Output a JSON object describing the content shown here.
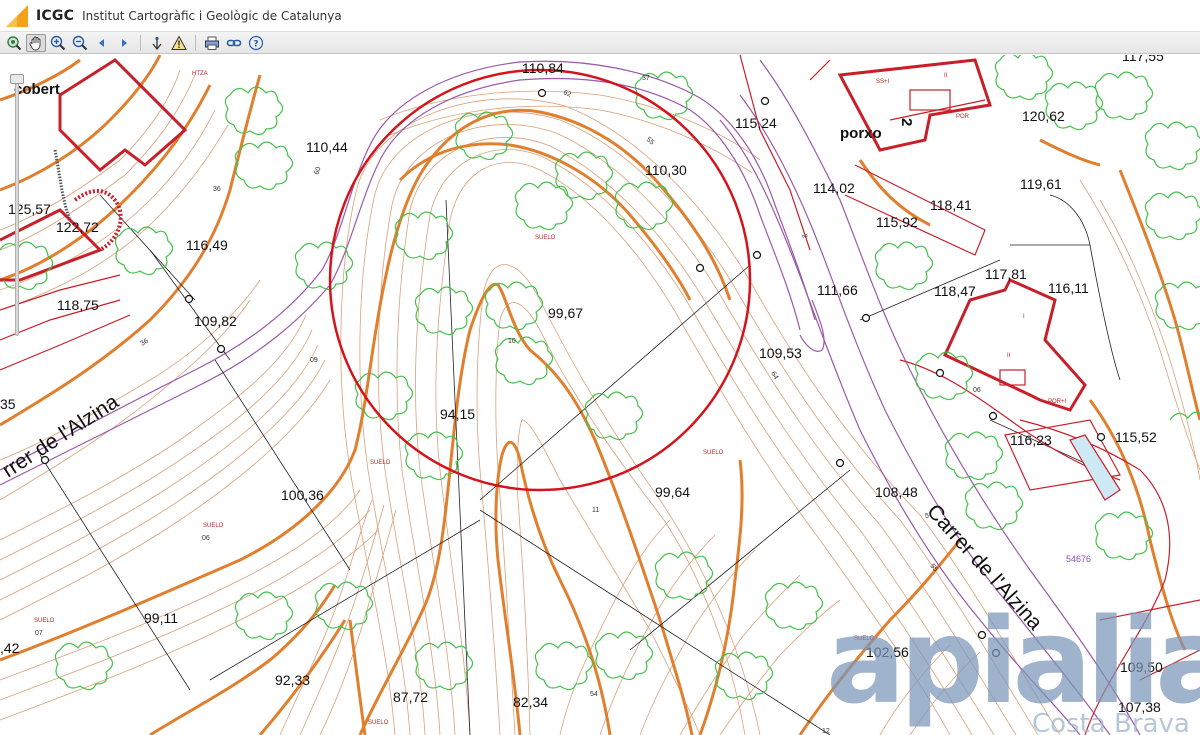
{
  "header": {
    "brand": "ICGC",
    "institution": "Institut Cartogràfic i Geològic de Catalunya"
  },
  "toolbar": {
    "buttons": [
      {
        "name": "zoom-extent-icon"
      },
      {
        "name": "pan-hand-icon",
        "active": true
      },
      {
        "name": "zoom-in-icon"
      },
      {
        "name": "zoom-out-icon"
      },
      {
        "name": "previous-view-icon"
      },
      {
        "name": "next-view-icon"
      },
      {
        "name": "info-icon"
      },
      {
        "name": "warning-icon"
      },
      {
        "name": "print-icon"
      },
      {
        "name": "link-icon"
      },
      {
        "name": "help-icon"
      }
    ]
  },
  "map": {
    "elevations": {
      "e110_84": "110,84",
      "e110_44": "110,44",
      "e115_24": "115,24",
      "e117_55": "117,55",
      "e120_62": "120,62",
      "e110_30": "110,30",
      "e119_61": "119,61",
      "e125_57": "125,57",
      "e122_72": "122,72",
      "e116_49": "116,49",
      "e114_02": "114,02",
      "e118_41": "118,41",
      "e115_92": "115,92",
      "e117_81": "117,81",
      "e118_47": "118,47",
      "e116_11": "116,11",
      "e111_66": "111,66",
      "e118_75": "118,75",
      "e109_82": "109,82",
      "e99_67": "99,67",
      "e109_53": "109,53",
      "e94_15": "94,15",
      "e116_23": "116,23",
      "e115_52": "115,52",
      "e100_36": "100,36",
      "e99_64": "99,64",
      "e108_48": "108,48",
      "e99_11": "99,11",
      "e102_56": "102,56",
      "e92_33": "92,33",
      "e87_72": "87,72",
      "e82_34": "82,34",
      "e109_50": "109,50",
      "e107_38": "107,38",
      "e_42": ",42",
      "e_35": "35"
    },
    "places": {
      "cobert": "cobert",
      "porxo": "porxo",
      "number2": "2"
    },
    "streets": {
      "left": "rrer de l'Alzina",
      "right": "Carrer de l'Alzina"
    },
    "small_labels": {
      "suelo": "SUELO",
      "n37": "37",
      "n62": "62",
      "n55": "55",
      "n60": "60",
      "n36": "36",
      "n09": "09",
      "n10": "10",
      "n64": "64",
      "n11": "11",
      "n06": "06",
      "n07": "07",
      "n54": "54",
      "n12": "12",
      "n2": "2",
      "n5": "5",
      "n06b": "06",
      "n55b": "55",
      "n36b": "36",
      "parcel": "54676",
      "por": "POR",
      "porI": "POR+I",
      "ssI": "SS+I",
      "ii": "II",
      "i": "I",
      "htza": "HTZA"
    }
  },
  "watermark": {
    "brand": "apialia",
    "sub": "Costa Brava"
  },
  "colors": {
    "contour_major": "#e07f2e",
    "contour_minor": "#d9a07a",
    "vegetation": "#43c24a",
    "building": "#c8202a",
    "circle": "#d4141c",
    "road_edge": "#9b5aa8",
    "parcel": "#111111"
  }
}
